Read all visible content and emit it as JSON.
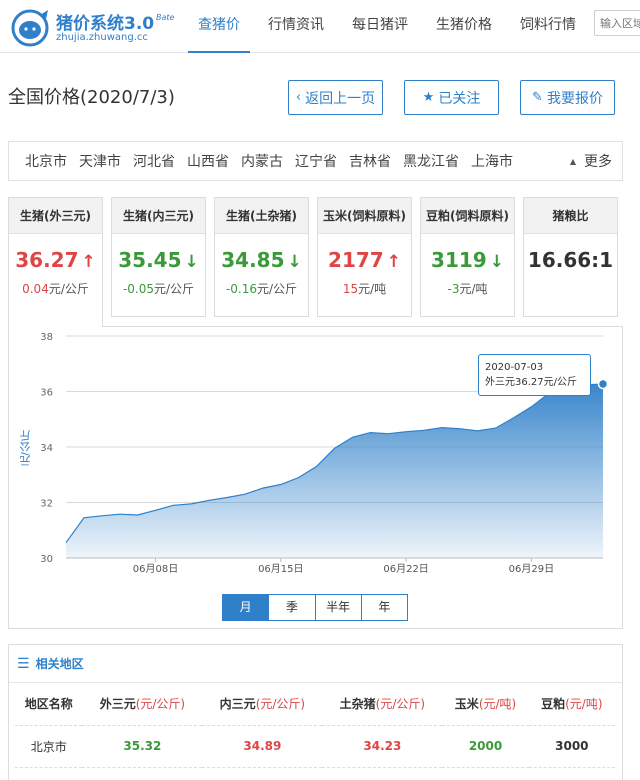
{
  "header": {
    "logo_title": "猪价系统3.0",
    "logo_beta": "Bate",
    "logo_url": "zhujia.zhuwang.cc",
    "nav": [
      "查猪价",
      "行情资讯",
      "每日猪评",
      "生猪价格",
      "饲料行情"
    ],
    "active_nav": 0,
    "search_placeholder": "输入区域"
  },
  "page": {
    "title": "全国价格(2020/7/3)",
    "btn_back": "返回上一页",
    "btn_follow": "已关注",
    "btn_report": "我要报价"
  },
  "regions": {
    "items": [
      "北京市",
      "天津市",
      "河北省",
      "山西省",
      "内蒙古",
      "辽宁省",
      "吉林省",
      "黑龙江省",
      "上海市"
    ],
    "more": "更多"
  },
  "cards": [
    {
      "title": "生猪(外三元)",
      "value": "36.27",
      "trend": "up",
      "change": "0.04",
      "unit": "元/公斤",
      "color": "red",
      "active": true
    },
    {
      "title": "生猪(内三元)",
      "value": "35.45",
      "trend": "down",
      "change": "-0.05",
      "unit": "元/公斤",
      "color": "green",
      "active": false
    },
    {
      "title": "生猪(土杂猪)",
      "value": "34.85",
      "trend": "down",
      "change": "-0.16",
      "unit": "元/公斤",
      "color": "green",
      "active": false
    },
    {
      "title": "玉米(饲料原料)",
      "value": "2177",
      "trend": "up",
      "change": "15",
      "unit": "元/吨",
      "color": "red",
      "active": false
    },
    {
      "title": "豆粕(饲料原料)",
      "value": "3119",
      "trend": "down",
      "change": "-3",
      "unit": "元/吨",
      "color": "green",
      "active": false
    },
    {
      "title": "猪粮比",
      "value": "16.66:1",
      "trend": "",
      "change": "",
      "unit": "",
      "color": "dark",
      "active": false
    }
  ],
  "chart_data": {
    "type": "area",
    "ylabel": "元/公斤",
    "ylim": [
      30,
      38
    ],
    "yticks": [
      30,
      32,
      34,
      36,
      38
    ],
    "grid": true,
    "x": [
      "2020-06-03",
      "2020-06-04",
      "2020-06-05",
      "2020-06-06",
      "2020-06-07",
      "2020-06-08",
      "2020-06-09",
      "2020-06-10",
      "2020-06-11",
      "2020-06-12",
      "2020-06-13",
      "2020-06-14",
      "2020-06-15",
      "2020-06-16",
      "2020-06-17",
      "2020-06-18",
      "2020-06-19",
      "2020-06-20",
      "2020-06-21",
      "2020-06-22",
      "2020-06-23",
      "2020-06-24",
      "2020-06-25",
      "2020-06-26",
      "2020-06-27",
      "2020-06-28",
      "2020-06-29",
      "2020-06-30",
      "2020-07-01",
      "2020-07-02",
      "2020-07-03"
    ],
    "values": [
      30.55,
      31.45,
      31.52,
      31.58,
      31.55,
      31.72,
      31.9,
      31.95,
      32.08,
      32.18,
      32.3,
      32.52,
      32.65,
      32.9,
      33.3,
      33.95,
      34.35,
      34.52,
      34.48,
      34.55,
      34.6,
      34.7,
      34.66,
      34.58,
      34.68,
      35.05,
      35.45,
      35.95,
      36.2,
      36.24,
      36.27
    ],
    "xticks": [
      "06月08日",
      "06月15日",
      "06月22日",
      "06月29日"
    ],
    "tooltip": {
      "date": "2020-07-03",
      "label": "外三元36.27元/公斤"
    }
  },
  "range_tabs": [
    "月",
    "季",
    "半年",
    "年"
  ],
  "active_range": 0,
  "related": {
    "title": "相关地区",
    "columns": [
      {
        "name": "地区名称",
        "unit": ""
      },
      {
        "name": "外三元",
        "unit": "(元/公斤)"
      },
      {
        "name": "内三元",
        "unit": "(元/公斤)"
      },
      {
        "name": "土杂猪",
        "unit": "(元/公斤)"
      },
      {
        "name": "玉米",
        "unit": "(元/吨)"
      },
      {
        "name": "豆粕",
        "unit": "(元/吨)"
      }
    ],
    "rows": [
      [
        "北京市",
        "35.32",
        "34.89",
        "34.23",
        "2000",
        "3000"
      ]
    ]
  },
  "colors": {
    "accent": "#2f80c9",
    "up": "#e04545",
    "down": "#3a9a3a"
  }
}
